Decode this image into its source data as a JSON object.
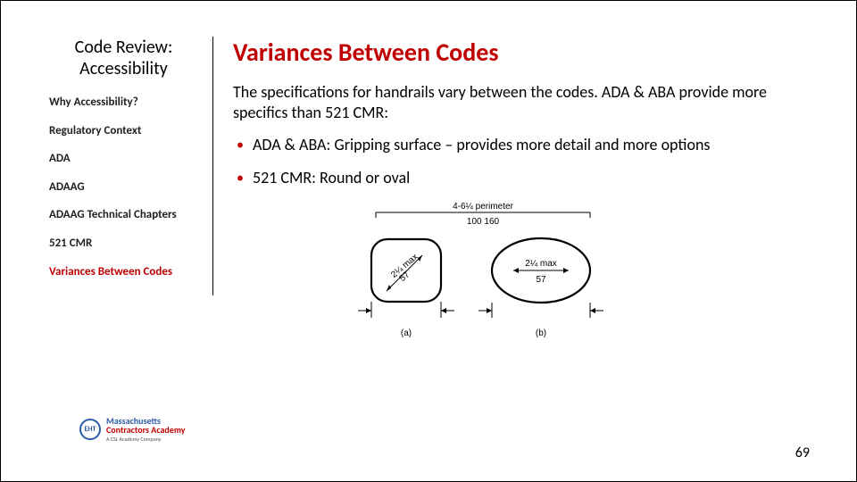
{
  "sidebar": {
    "title_line1": "Code Review:",
    "title_line2": "Accessibility",
    "items": [
      {
        "label": "Why Accessibility?",
        "current": false
      },
      {
        "label": "Regulatory Context",
        "current": false
      },
      {
        "label": "ADA",
        "current": false
      },
      {
        "label": "ADAAG",
        "current": false
      },
      {
        "label": "ADAAG Technical Chapters",
        "current": false
      },
      {
        "label": "521 CMR",
        "current": false
      },
      {
        "label": "Variances Between Codes",
        "current": true
      }
    ]
  },
  "main": {
    "title": "Variances Between Codes",
    "intro": "The specifications for handrails vary between the codes. ADA & ABA provide more specifics than 521 CMR:",
    "bullets": [
      "ADA & ABA: Gripping surface – provides more detail and more options",
      "521 CMR: Round or oval"
    ]
  },
  "figure": {
    "top_label": "4-6¼ perimeter",
    "top_sub": "100 160",
    "shape_a": {
      "label": "(a)",
      "dim_top": "2¼ max",
      "dim_bottom": "57"
    },
    "shape_b": {
      "label": "(b)",
      "dim_top": "2¼ max",
      "dim_bottom": "57"
    }
  },
  "logo": {
    "badge": "EHT",
    "line1": "Massachusetts",
    "line2": "Contractors Academy",
    "tag": "A CSL Academy Company"
  },
  "page_number": "69"
}
